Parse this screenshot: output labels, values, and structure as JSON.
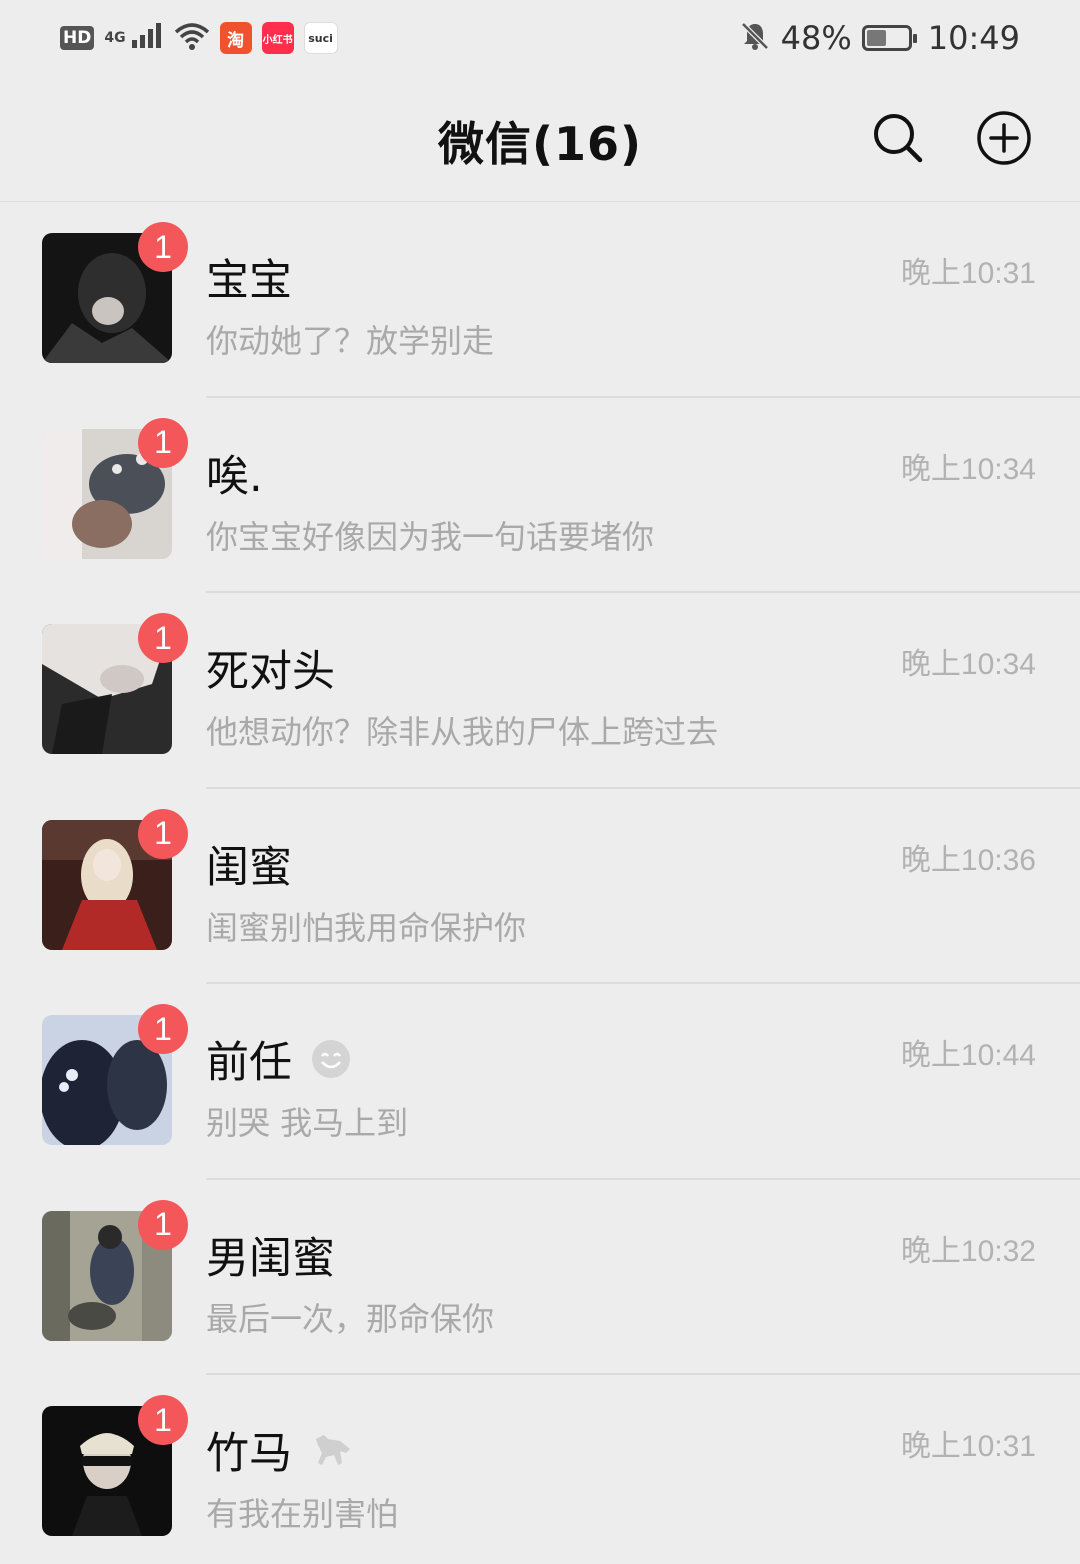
{
  "status_bar": {
    "hd": "HD",
    "network": "4G",
    "apps": [
      "淘",
      "小红书",
      "suci"
    ],
    "battery": "48%",
    "battery_level": 0.48,
    "time": "10:49",
    "icons": [
      "signal-icon",
      "wifi-icon",
      "mute-bell-icon",
      "battery-icon"
    ]
  },
  "header": {
    "title": "微信(16)",
    "icons": [
      "search-icon",
      "add-circle-icon"
    ]
  },
  "chats": [
    {
      "name": "宝宝",
      "time": "晚上10:31",
      "preview": "你动她了？放学别走",
      "unread": "1",
      "avatar_color": "#1a1a1a"
    },
    {
      "name": "唉.",
      "time": "晚上10:34",
      "preview": "你宝宝好像因为我一句话要堵你",
      "unread": "1",
      "avatar_color": "#6b6b6b"
    },
    {
      "name": "死对头",
      "time": "晚上10:34",
      "preview": "他想动你？除非从我的尸体上跨过去",
      "unread": "1",
      "avatar_color": "#3a3a3a"
    },
    {
      "name": "闺蜜",
      "time": "晚上10:36",
      "preview": "闺蜜别怕我用命保护你",
      "unread": "1",
      "avatar_color": "#8a2a2a"
    },
    {
      "name": "前任",
      "time": "晚上10:44",
      "preview": "别哭  我马上到",
      "unread": "1",
      "avatar_color": "#2c3550",
      "name_icon": "smile-emoji-icon"
    },
    {
      "name": "男闺蜜",
      "time": "晚上10:32",
      "preview": "最后一次，那命保你",
      "unread": "1",
      "avatar_color": "#7d7a6c"
    },
    {
      "name": "竹马",
      "time": "晚上10:31",
      "preview": "有我在别害怕",
      "unread": "1",
      "avatar_color": "#111111",
      "name_icon": "running-horse-icon"
    }
  ],
  "colors": {
    "background": "#ededed",
    "badge": "#f3575a",
    "time_text": "#b2b2b2",
    "preview_text": "#a9a9a9"
  }
}
